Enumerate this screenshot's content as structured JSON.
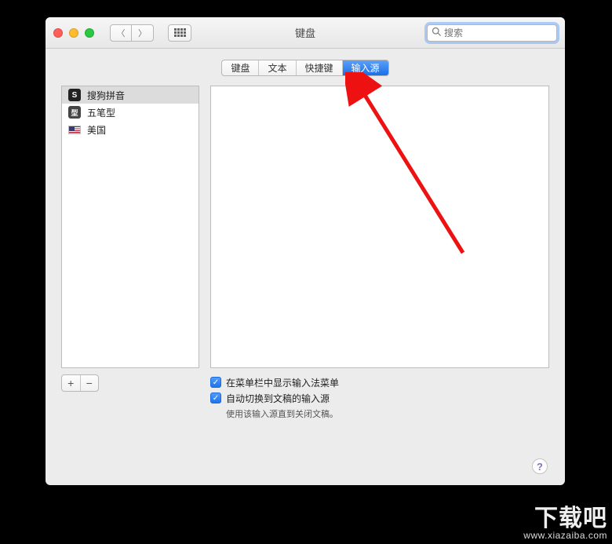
{
  "window": {
    "title": "键盘"
  },
  "toolbar": {
    "back_icon": "chevron-left",
    "forward_icon": "chevron-right",
    "apps_icon": "grid"
  },
  "search": {
    "placeholder": "搜索",
    "value": ""
  },
  "tabs": [
    {
      "label": "键盘",
      "active": false
    },
    {
      "label": "文本",
      "active": false
    },
    {
      "label": "快捷键",
      "active": false
    },
    {
      "label": "输入源",
      "active": true
    }
  ],
  "sources": [
    {
      "icon": "sogou",
      "glyph": "S",
      "label": "搜狗拼音",
      "selected": true
    },
    {
      "icon": "wubi",
      "glyph": "型",
      "label": "五笔型",
      "selected": false
    },
    {
      "icon": "us-flag",
      "glyph": "",
      "label": "美国",
      "selected": false
    }
  ],
  "buttons": {
    "add": "+",
    "remove": "−"
  },
  "options": {
    "show_in_menu_bar": {
      "checked": true,
      "label": "在菜单栏中显示输入法菜单"
    },
    "auto_switch": {
      "checked": true,
      "label": "自动切换到文稿的输入源"
    },
    "hint": "使用该输入源直到关闭文稿。"
  },
  "help": {
    "label": "?"
  },
  "watermark": {
    "brand": "下载吧",
    "url": "www.xiazaiba.com"
  }
}
